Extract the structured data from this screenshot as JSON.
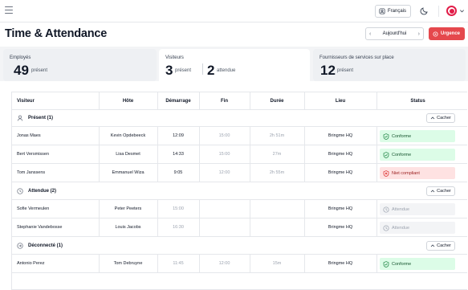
{
  "topbar": {
    "language_label": "Français",
    "icons": {
      "menu": "menu-icon",
      "language": "user-badge-icon",
      "theme": "moon-icon",
      "avatar": "avatar-icon",
      "dropdown": "chevron-down-icon"
    }
  },
  "header": {
    "title": "Time & Attendance",
    "date_label": "Aujourd'hui",
    "emergency_label": "Urgence"
  },
  "summary": {
    "employees": {
      "label": "Employés",
      "count": "49",
      "sub": "présent"
    },
    "visitors": {
      "label": "Visiteurs",
      "present_count": "3",
      "present_sub": "présent",
      "expected_count": "2",
      "expected_sub": "attendue"
    },
    "vendors": {
      "label": "Fournisseurs de services sur place",
      "count": "12",
      "sub": "présent"
    }
  },
  "table": {
    "columns": [
      "Visiteur",
      "Hôte",
      "Démarrage",
      "Fin",
      "Durée",
      "Lieu",
      "Status"
    ],
    "hide_label": "Cacher",
    "groups": [
      {
        "title": "Présent (1)",
        "icon": "user-icon",
        "rows": [
          {
            "visitor": "Jonas Maes",
            "host": "Kevin Opdebeeck",
            "start": "12:09",
            "end": "15:00",
            "duration": "2h 51m",
            "location": "Bringme HQ",
            "status": "Conforme",
            "status_type": "ok"
          },
          {
            "visitor": "Bert Versmissen",
            "host": "Lisa Desmet",
            "start": "14:33",
            "end": "15:00",
            "duration": "27m",
            "location": "Bringme HQ",
            "status": "Conforme",
            "status_type": "ok"
          },
          {
            "visitor": "Tom Janssens",
            "host": "Emmanuel Wiza",
            "start": "9:05",
            "end": "12:00",
            "duration": "2h 55m",
            "location": "Bringme HQ",
            "status": "Niet compliant",
            "status_type": "bad"
          }
        ]
      },
      {
        "title": "Attendue (2)",
        "icon": "clock-icon",
        "rows": [
          {
            "visitor": "Sofie Vermeulen",
            "host": "Peter Peeters",
            "start": "15:00",
            "end": "",
            "duration": "",
            "location": "Bringme HQ",
            "status": "Attendue",
            "status_type": "wait"
          },
          {
            "visitor": "Stephanie Vandebosse",
            "host": "Louis Jacobs",
            "start": "16:30",
            "end": "",
            "duration": "",
            "location": "Bringme HQ",
            "status": "Attendue",
            "status_type": "wait"
          }
        ]
      },
      {
        "title": "Déconnecté (1)",
        "icon": "arrow-circle-icon",
        "rows": [
          {
            "visitor": "Antonio Perez",
            "host": "Tom Debruyne",
            "start": "11:45",
            "end": "12:00",
            "duration": "15m",
            "location": "Bringme HQ",
            "status": "Conforme",
            "status_type": "ok"
          }
        ]
      }
    ]
  }
}
